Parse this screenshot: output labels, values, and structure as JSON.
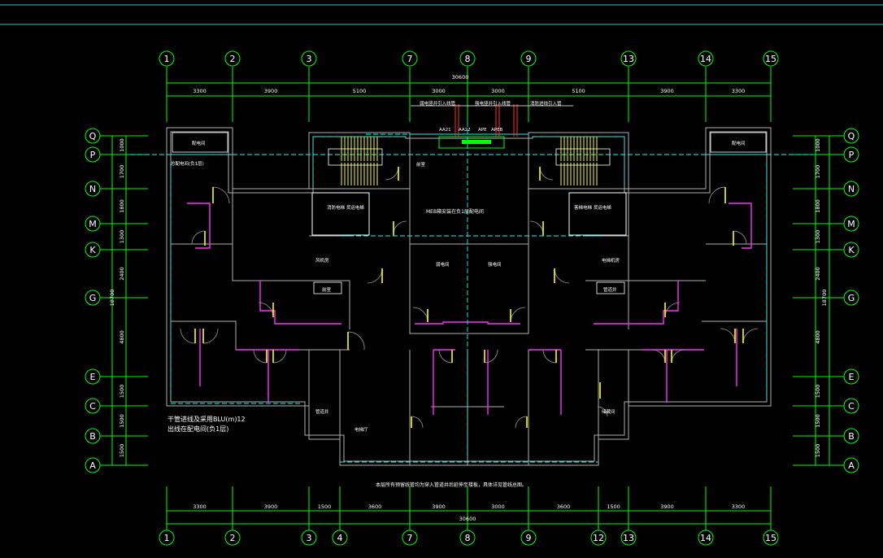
{
  "drawing": {
    "axes_top": [
      "1",
      "2",
      "3",
      "7",
      "8",
      "9",
      "13",
      "14",
      "15"
    ],
    "axes_bottom": [
      "1",
      "2",
      "3",
      "4",
      "7",
      "8",
      "9",
      "12",
      "13",
      "14",
      "15"
    ],
    "axes_left": [
      "Q",
      "P",
      "N",
      "M",
      "K",
      "G",
      "E",
      "C",
      "B",
      "A"
    ],
    "axes_right": [
      "Q",
      "P",
      "N",
      "M",
      "K",
      "G",
      "E",
      "C",
      "B",
      "A"
    ],
    "dims_top": [
      "3300",
      "3900",
      "5100",
      "3000",
      "3000",
      "5100",
      "3900",
      "3300"
    ],
    "dims_bottom": [
      "3300",
      "3900",
      "1500",
      "3600",
      "3900",
      "3000",
      "3600",
      "1500",
      "3900",
      "3300"
    ],
    "total_top": "30600",
    "total_bottom": "30600",
    "dims_left": [
      "1000",
      "1700",
      "1800",
      "1300",
      "2400",
      "4800",
      "1500",
      "1500",
      "1500"
    ],
    "dims_right": [
      "1000",
      "1700",
      "1800",
      "1300",
      "2400",
      "4800",
      "1500",
      "1500",
      "1500"
    ],
    "total_left": "18700",
    "total_right": "18700",
    "labels": {
      "top_note_1": "弱电竖井引入线管",
      "top_note_2": "强电竖井引入线管",
      "top_note_3": "消防进线引入管",
      "cable_tags": [
        "AA21",
        "AA22",
        "APE",
        "APEB"
      ],
      "equip_room": "MEB箱安装在负1层配电间",
      "elevator_left": "消防电梯 货运电梯",
      "elevator_right": "客梯电梯 货运电梯",
      "left_room": "配电间",
      "left_note": "总配电间(负1层)",
      "pipe_note_1": "干管进线及采用BLU(m)12",
      "pipe_note_2": "出线在配电间(负1层)",
      "shaft_1": "管道井",
      "shaft_2": "配电间",
      "corridor_1": "前室",
      "corridor_2": "前室",
      "room_a": "风机房",
      "room_b": "电梯机房",
      "room_c": "弱电间",
      "room_d": "强电间",
      "room_e": "电梯厅",
      "room_f": "储藏间",
      "bottom_note": "本层所有预留线管均为穿入管道井后延伸至楼板，具体详见管线总图。"
    }
  }
}
